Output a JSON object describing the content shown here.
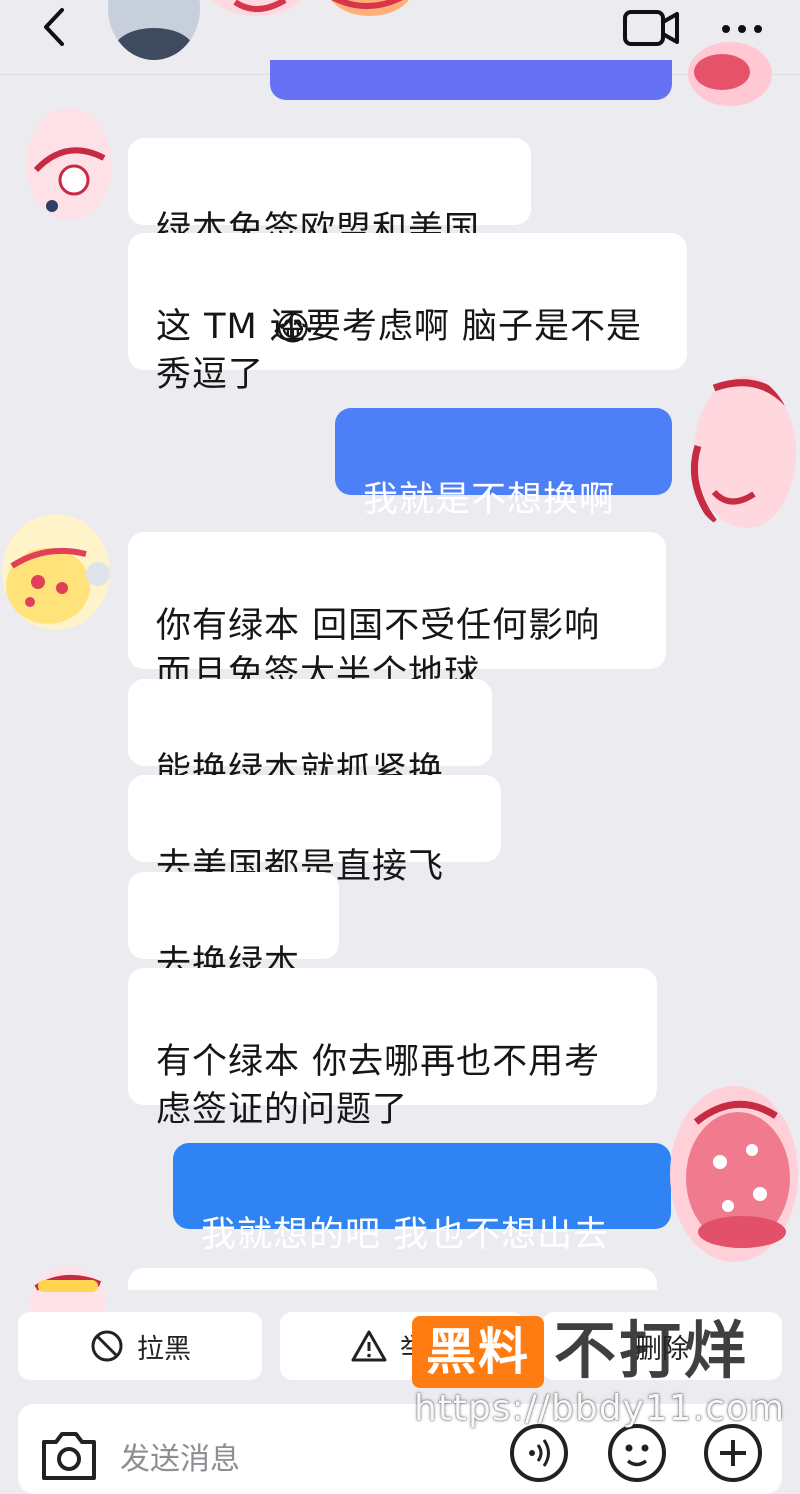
{
  "header": {
    "title": ""
  },
  "messages": [
    {
      "from": "other",
      "text": "绿本免签欧盟和美国"
    },
    {
      "from": "other",
      "text": "这 TM 还要考虑啊 脑子是不是\n秀逗了"
    },
    {
      "from": "me",
      "text": "我就是不想换啊"
    },
    {
      "from": "other",
      "text": "你有绿本 回国不受任何影响\n而且免签大半个地球"
    },
    {
      "from": "other",
      "text": "能换绿本就抓紧换"
    },
    {
      "from": "other",
      "text": "去美国都是直接飞"
    },
    {
      "from": "other",
      "text": "去换绿本"
    },
    {
      "from": "other",
      "text": "有个绿本 你去哪再也不用考\n虑签证的问题了"
    },
    {
      "from": "me",
      "text": "我就想的吧 我也不想出去"
    }
  ],
  "emoji": {
    "laugh_cry": "😂"
  },
  "actions": {
    "block_label": "拉黑",
    "report_label": "举报",
    "delete_label": "删除"
  },
  "input": {
    "placeholder": "发送消息"
  },
  "watermark": {
    "brand_box": "黑料",
    "brand_word": "不打烊",
    "url": "https://bbdy11.com"
  },
  "colors": {
    "background": "#ecebf0",
    "bubble_other": "#ffffff",
    "bubble_me": "#4d7ff7",
    "bubble_me_last": "#2f83f2",
    "watermark_orange": "#ff7c12"
  }
}
